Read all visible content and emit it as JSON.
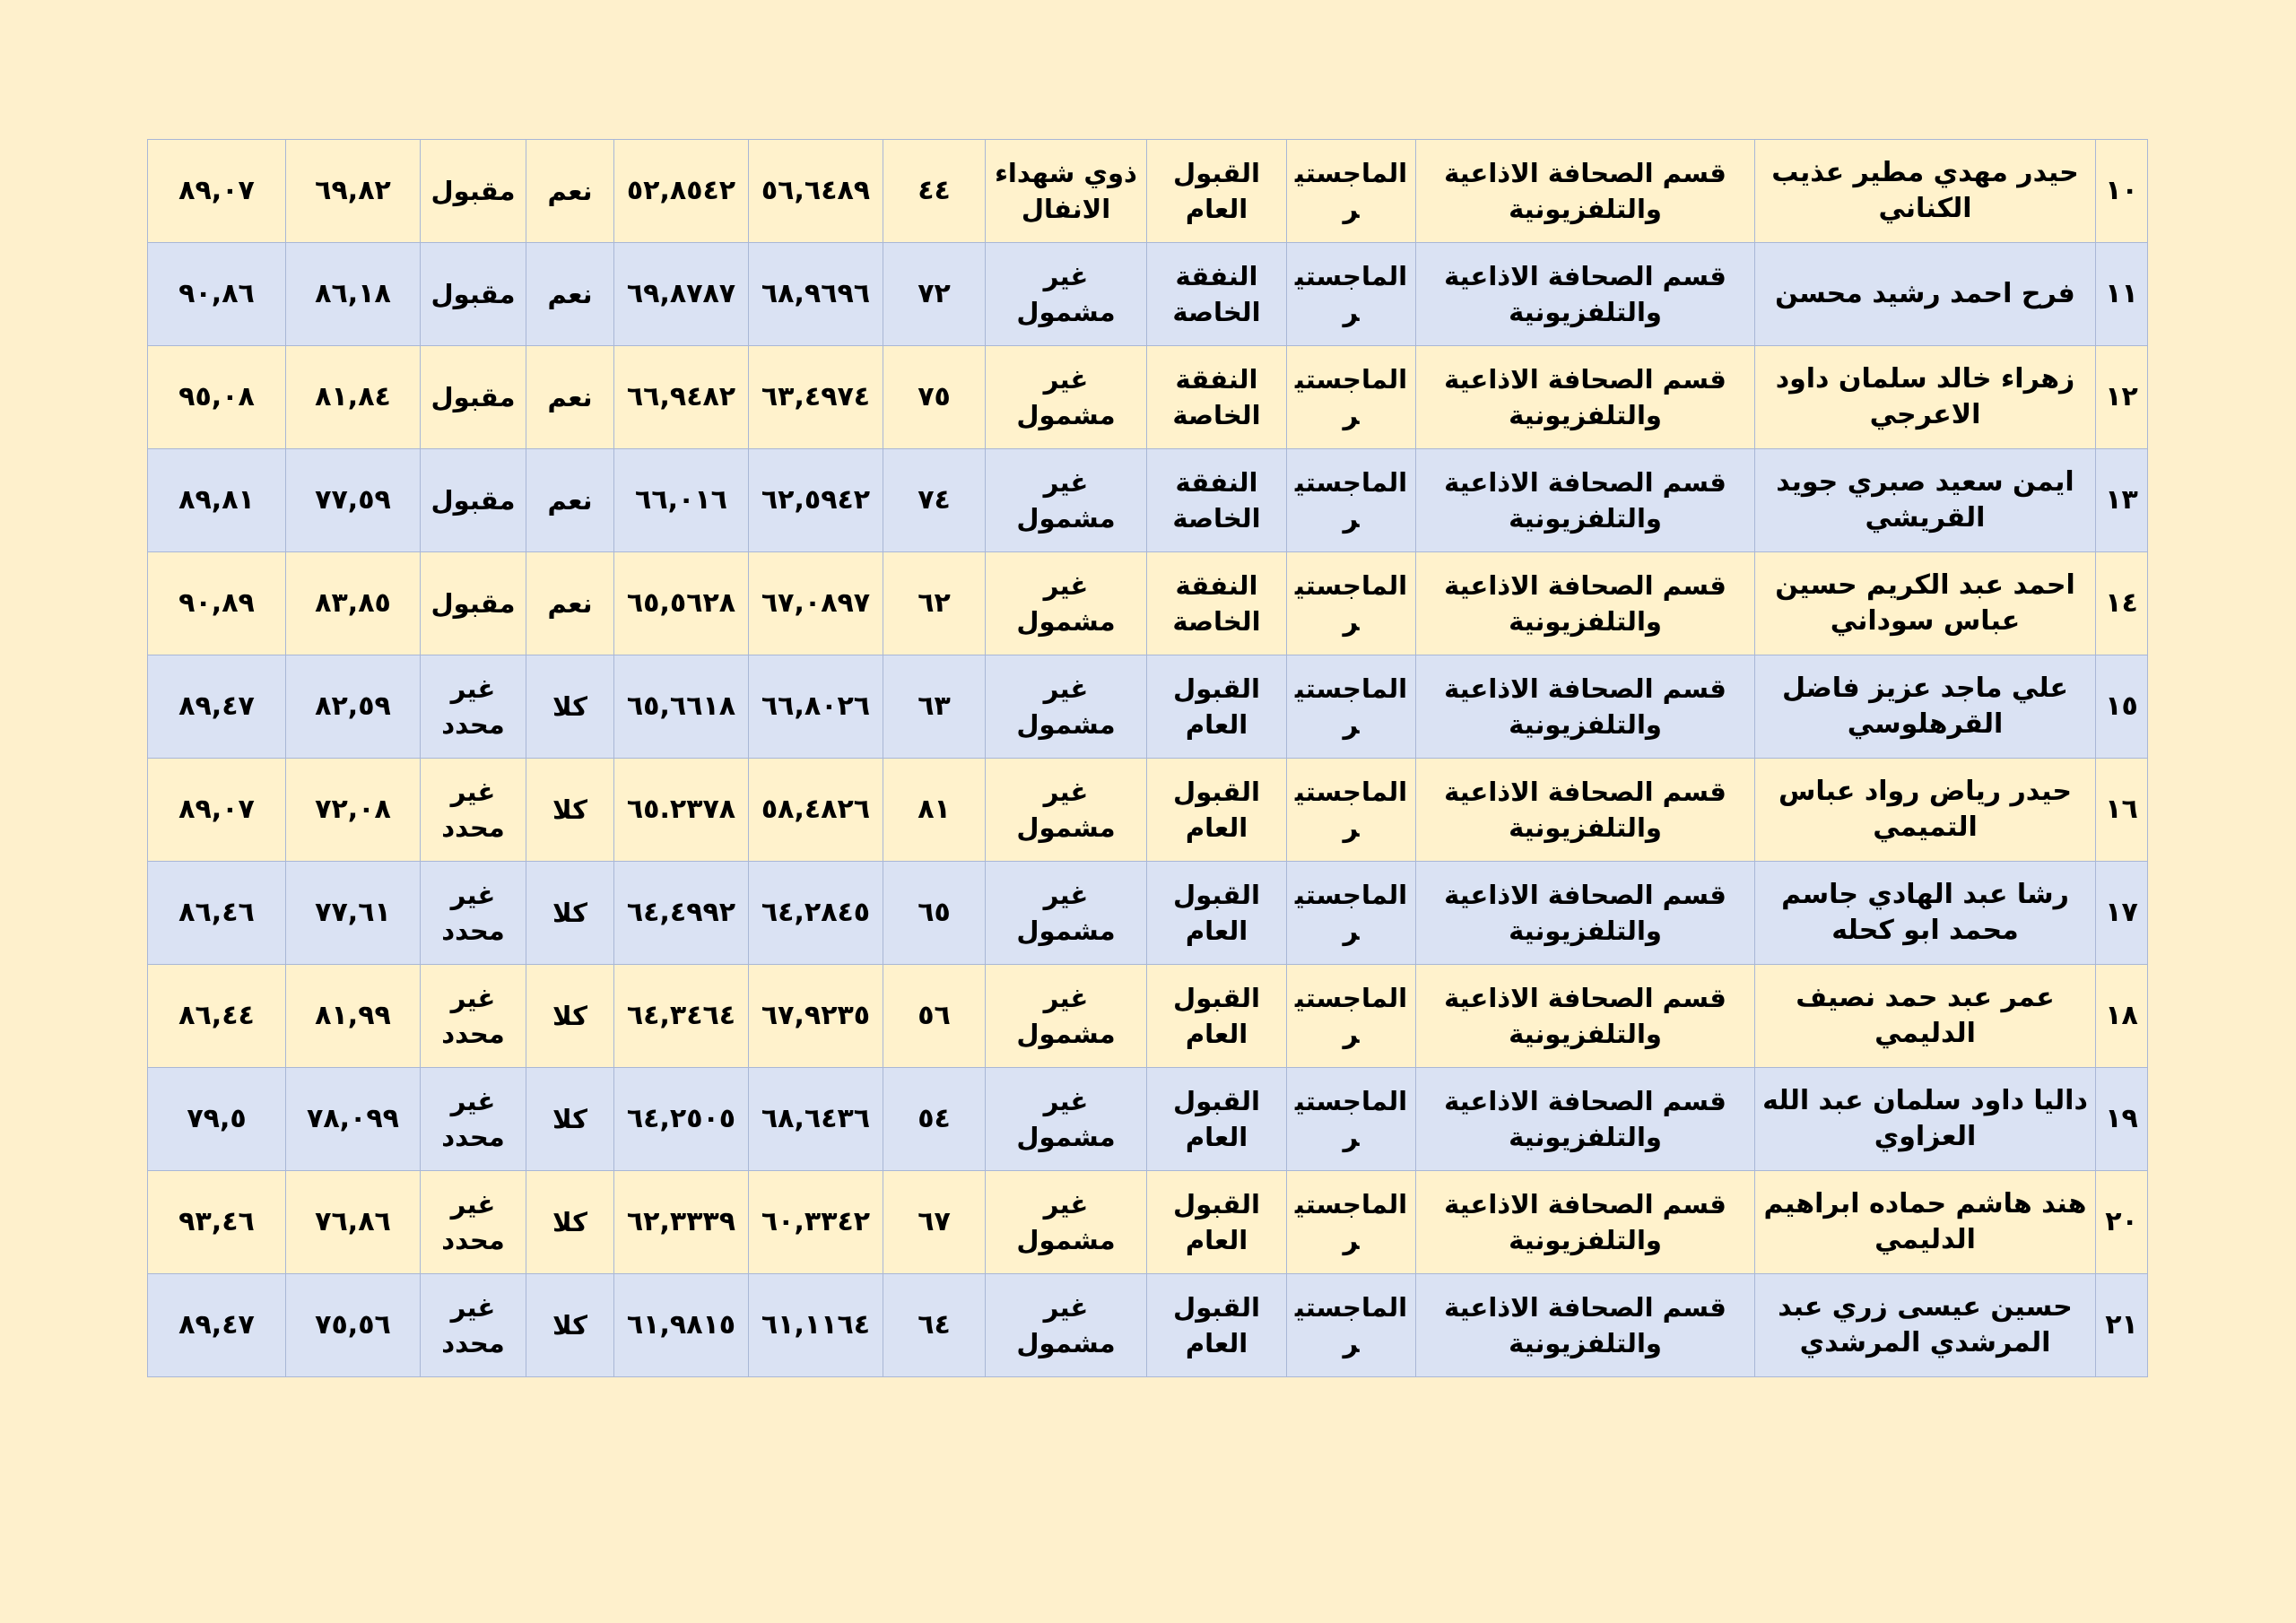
{
  "table": {
    "rows": [
      {
        "seq": "١٠",
        "name": "حيدر مهدي مطير عذيب الكناني",
        "department": "قسم الصحافة الاذاعية والتلفزيونية",
        "degree": "الماجستير",
        "admission_channel": "القبول العام",
        "category": "ذوي شهداء الانفال",
        "value_1": "٤٤",
        "value_2": "٥٦,٦٤٨٩",
        "value_3": "٥٢,٨٥٤٢",
        "answer": "نعم",
        "status": "مقبول",
        "value_4": "٦٩,٨٢",
        "value_5": "٨٩,٠٧"
      },
      {
        "seq": "١١",
        "name": "فرح احمد رشيد محسن",
        "department": "قسم الصحافة الاذاعية والتلفزيونية",
        "degree": "الماجستير",
        "admission_channel": "النفقة الخاصة",
        "category": "غير مشمول",
        "value_1": "٧٢",
        "value_2": "٦٨,٩٦٩٦",
        "value_3": "٦٩,٨٧٨٧",
        "answer": "نعم",
        "status": "مقبول",
        "value_4": "٨٦,١٨",
        "value_5": "٩٠,٨٦"
      },
      {
        "seq": "١٢",
        "name": "زهراء خالد سلمان داود الاعرجي",
        "department": "قسم الصحافة الاذاعية والتلفزيونية",
        "degree": "الماجستير",
        "admission_channel": "النفقة الخاصة",
        "category": "غير مشمول",
        "value_1": "٧٥",
        "value_2": "٦٣,٤٩٧٤",
        "value_3": "٦٦,٩٤٨٢",
        "answer": "نعم",
        "status": "مقبول",
        "value_4": "٨١,٨٤",
        "value_5": "٩٥,٠٨"
      },
      {
        "seq": "١٣",
        "name": "ايمن سعيد صبري جويد القريشي",
        "department": "قسم الصحافة الاذاعية والتلفزيونية",
        "degree": "الماجستير",
        "admission_channel": "النفقة الخاصة",
        "category": "غير مشمول",
        "value_1": "٧٤",
        "value_2": "٦٢,٥٩٤٢",
        "value_3": "٦٦,٠١٦",
        "answer": "نعم",
        "status": "مقبول",
        "value_4": "٧٧,٥٩",
        "value_5": "٨٩,٨١"
      },
      {
        "seq": "١٤",
        "name": "احمد عبد الكريم حسين عباس سوداني",
        "department": "قسم الصحافة الاذاعية والتلفزيونية",
        "degree": "الماجستير",
        "admission_channel": "النفقة الخاصة",
        "category": "غير مشمول",
        "value_1": "٦٢",
        "value_2": "٦٧,٠٨٩٧",
        "value_3": "٦٥,٥٦٢٨",
        "answer": "نعم",
        "status": "مقبول",
        "value_4": "٨٣,٨٥",
        "value_5": "٩٠,٨٩"
      },
      {
        "seq": "١٥",
        "name": "علي ماجد عزيز فاضل القرهلوسي",
        "department": "قسم الصحافة الاذاعية والتلفزيونية",
        "degree": "الماجستير",
        "admission_channel": "القبول العام",
        "category": "غير مشمول",
        "value_1": "٦٣",
        "value_2": "٦٦,٨٠٢٦",
        "value_3": "٦٥,٦٦١٨",
        "answer": "كلا",
        "status": "غير محدد",
        "value_4": "٨٢,٥٩",
        "value_5": "٨٩,٤٧"
      },
      {
        "seq": "١٦",
        "name": "حيدر رياض رواد عباس التميمي",
        "department": "قسم الصحافة الاذاعية والتلفزيونية",
        "degree": "الماجستير",
        "admission_channel": "القبول العام",
        "category": "غير مشمول",
        "value_1": "٨١",
        "value_2": "٥٨,٤٨٢٦",
        "value_3": "٦٥.٢٣٧٨",
        "answer": "كلا",
        "status": "غير محدد",
        "value_4": "٧٢,٠٨",
        "value_5": "٨٩,٠٧"
      },
      {
        "seq": "١٧",
        "name": "رشا عبد الهادي جاسم محمد ابو كحله",
        "department": "قسم الصحافة الاذاعية والتلفزيونية",
        "degree": "الماجستير",
        "admission_channel": "القبول العام",
        "category": "غير مشمول",
        "value_1": "٦٥",
        "value_2": "٦٤,٢٨٤٥",
        "value_3": "٦٤,٤٩٩٢",
        "answer": "كلا",
        "status": "غير محدد",
        "value_4": "٧٧,٦١",
        "value_5": "٨٦,٤٦"
      },
      {
        "seq": "١٨",
        "name": "عمر عبد حمد نصيف الدليمي",
        "department": "قسم الصحافة الاذاعية والتلفزيونية",
        "degree": "الماجستير",
        "admission_channel": "القبول العام",
        "category": "غير مشمول",
        "value_1": "٥٦",
        "value_2": "٦٧,٩٢٣٥",
        "value_3": "٦٤,٣٤٦٤",
        "answer": "كلا",
        "status": "غير محدد",
        "value_4": "٨١,٩٩",
        "value_5": "٨٦,٤٤"
      },
      {
        "seq": "١٩",
        "name": "داليا داود سلمان عبد الله العزاوي",
        "department": "قسم الصحافة الاذاعية والتلفزيونية",
        "degree": "الماجستير",
        "admission_channel": "القبول العام",
        "category": "غير مشمول",
        "value_1": "٥٤",
        "value_2": "٦٨,٦٤٣٦",
        "value_3": "٦٤,٢٥٠٥",
        "answer": "كلا",
        "status": "غير محدد",
        "value_4": "٧٨,٠٩٩",
        "value_5": "٧٩,٥"
      },
      {
        "seq": "٢٠",
        "name": "هند هاشم حماده ابراهيم الدليمي",
        "department": "قسم الصحافة الاذاعية والتلفزيونية",
        "degree": "الماجستير",
        "admission_channel": "القبول العام",
        "category": "غير مشمول",
        "value_1": "٦٧",
        "value_2": "٦٠,٣٣٤٢",
        "value_3": "٦٢,٣٣٣٩",
        "answer": "كلا",
        "status": "غير محدد",
        "value_4": "٧٦,٨٦",
        "value_5": "٩٣,٤٦"
      },
      {
        "seq": "٢١",
        "name": "حسين عيسى زري عبد المرشدي المرشدي",
        "department": "قسم الصحافة الاذاعية والتلفزيونية",
        "degree": "الماجستير",
        "admission_channel": "القبول العام",
        "category": "غير مشمول",
        "value_1": "٦٤",
        "value_2": "٦١,١١٦٤",
        "value_3": "٦١,٩٨١٥",
        "answer": "كلا",
        "status": "غير محدد",
        "value_4": "٧٥,٥٦",
        "value_5": "٨٩,٤٧"
      }
    ]
  },
  "colors": {
    "page_background": "#fef0cc",
    "row_odd": "#fff2cc",
    "row_even": "#dae2f3",
    "border": "#a9b7d6"
  }
}
